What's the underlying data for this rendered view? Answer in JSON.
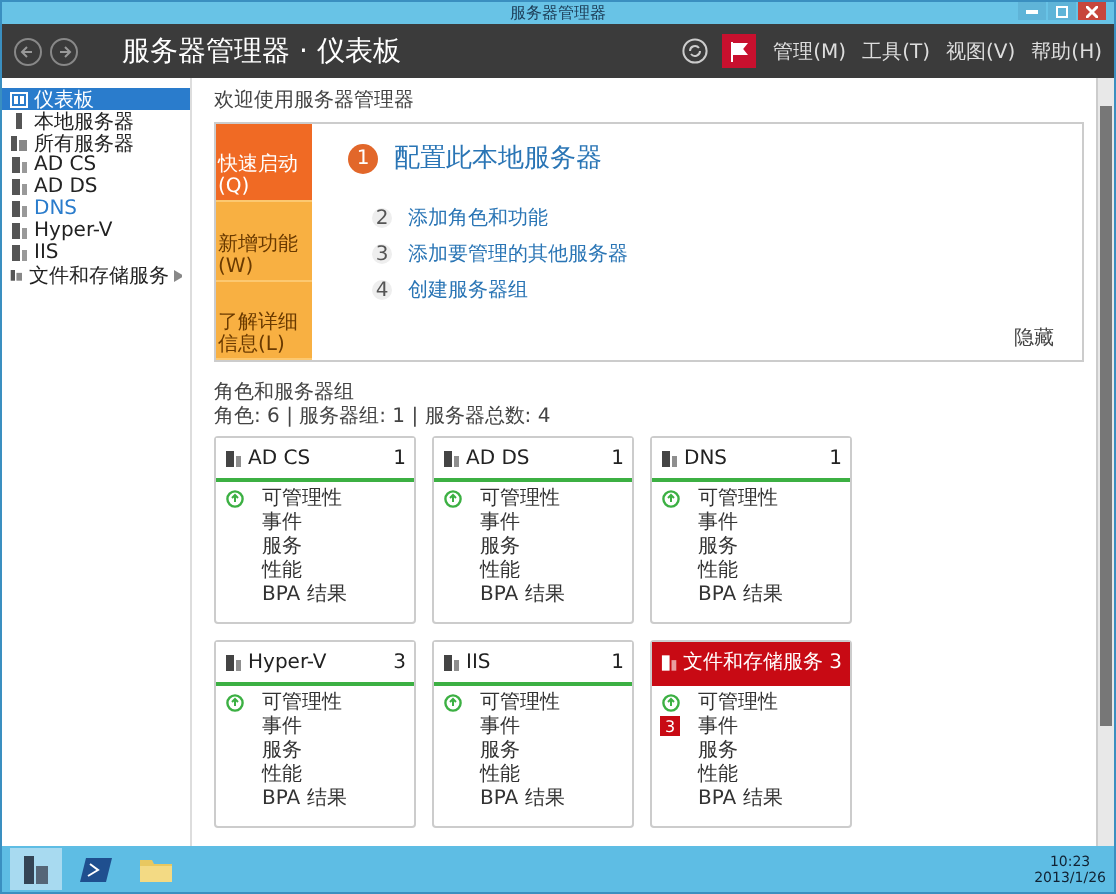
{
  "window": {
    "title": "服务器管理器"
  },
  "header": {
    "title": "服务器管理器 · 仪表板",
    "menu": [
      "管理(M)",
      "工具(T)",
      "视图(V)",
      "帮助(H)"
    ]
  },
  "sidebar": {
    "items": [
      {
        "label": "仪表板",
        "kind": "dashboard",
        "selected": true,
        "hovered": false,
        "expandable": false
      },
      {
        "label": "本地服务器",
        "kind": "server",
        "selected": false,
        "hovered": false,
        "expandable": false
      },
      {
        "label": "所有服务器",
        "kind": "servers",
        "selected": false,
        "hovered": false,
        "expandable": false
      },
      {
        "label": "AD CS",
        "kind": "role",
        "selected": false,
        "hovered": false,
        "expandable": false
      },
      {
        "label": "AD DS",
        "kind": "role",
        "selected": false,
        "hovered": false,
        "expandable": false
      },
      {
        "label": "DNS",
        "kind": "role",
        "selected": false,
        "hovered": true,
        "expandable": false
      },
      {
        "label": "Hyper-V",
        "kind": "role",
        "selected": false,
        "hovered": false,
        "expandable": false
      },
      {
        "label": "IIS",
        "kind": "role",
        "selected": false,
        "hovered": false,
        "expandable": false
      },
      {
        "label": "文件和存储服务",
        "kind": "servers",
        "selected": false,
        "hovered": false,
        "expandable": true
      }
    ]
  },
  "welcome": "欢迎使用服务器管理器",
  "quick_start": {
    "tiles": [
      {
        "label": "快速启动(Q)",
        "selected": true
      },
      {
        "label": "新增功能(W)",
        "selected": false
      },
      {
        "label": "了解详细信息(L)",
        "selected": false
      }
    ],
    "steps": [
      {
        "number": "1",
        "label": "配置此本地服务器",
        "primary": true
      },
      {
        "number": "2",
        "label": "添加角色和功能",
        "primary": false
      },
      {
        "number": "3",
        "label": "添加要管理的其他服务器",
        "primary": false
      },
      {
        "number": "4",
        "label": "创建服务器组",
        "primary": false
      }
    ],
    "hide": "隐藏"
  },
  "roles": {
    "title": "角色和服务器组",
    "summary": "角色: 6 | 服务器组: 1 | 服务器总数: 4",
    "cards": [
      {
        "name": "AD CS",
        "count": "1",
        "alert": false,
        "rows": [
          {
            "label": "可管理性",
            "healthy": true
          },
          {
            "label": "事件",
            "healthy": false
          },
          {
            "label": "服务",
            "healthy": false
          },
          {
            "label": "性能",
            "healthy": false
          },
          {
            "label": "BPA 结果",
            "healthy": false
          }
        ]
      },
      {
        "name": "AD DS",
        "count": "1",
        "alert": false,
        "rows": [
          {
            "label": "可管理性",
            "healthy": true
          },
          {
            "label": "事件",
            "healthy": false
          },
          {
            "label": "服务",
            "healthy": false
          },
          {
            "label": "性能",
            "healthy": false
          },
          {
            "label": "BPA 结果",
            "healthy": false
          }
        ]
      },
      {
        "name": "DNS",
        "count": "1",
        "alert": false,
        "rows": [
          {
            "label": "可管理性",
            "healthy": true
          },
          {
            "label": "事件",
            "healthy": false
          },
          {
            "label": "服务",
            "healthy": false
          },
          {
            "label": "性能",
            "healthy": false
          },
          {
            "label": "BPA 结果",
            "healthy": false
          }
        ]
      },
      {
        "name": "Hyper-V",
        "count": "3",
        "alert": false,
        "rows": [
          {
            "label": "可管理性",
            "healthy": true
          },
          {
            "label": "事件",
            "healthy": false
          },
          {
            "label": "服务",
            "healthy": false
          },
          {
            "label": "性能",
            "healthy": false
          },
          {
            "label": "BPA 结果",
            "healthy": false
          }
        ]
      },
      {
        "name": "IIS",
        "count": "1",
        "alert": false,
        "rows": [
          {
            "label": "可管理性",
            "healthy": true
          },
          {
            "label": "事件",
            "healthy": false
          },
          {
            "label": "服务",
            "healthy": false
          },
          {
            "label": "性能",
            "healthy": false
          },
          {
            "label": "BPA 结果",
            "healthy": false
          }
        ]
      },
      {
        "name": "文件和存储服务",
        "count": "3",
        "alert": true,
        "rows": [
          {
            "label": "可管理性",
            "healthy": true
          },
          {
            "label": "事件",
            "healthy": false,
            "badge": "3"
          },
          {
            "label": "服务",
            "healthy": false
          },
          {
            "label": "性能",
            "healthy": false
          },
          {
            "label": "BPA 结果",
            "healthy": false
          }
        ]
      }
    ]
  },
  "taskbar": {
    "apps": [
      {
        "kind": "server-manager",
        "selected": true
      },
      {
        "kind": "powershell",
        "selected": false
      },
      {
        "kind": "explorer",
        "selected": false
      }
    ],
    "clock": {
      "time": "10:23",
      "date": "2013/1/26"
    }
  }
}
